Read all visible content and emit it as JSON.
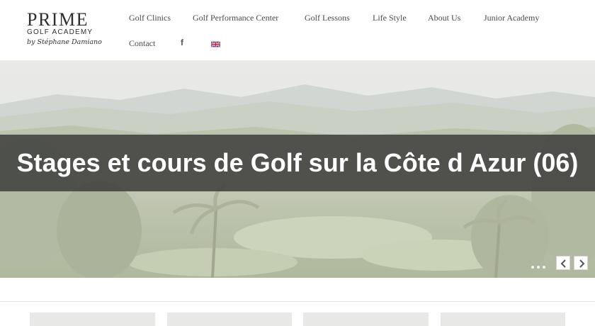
{
  "logo": {
    "main": "PRIME",
    "sub": "GOLF ACADEMY",
    "signature": "by Stéphane Damiano"
  },
  "nav": {
    "items": [
      {
        "label": "Golf Clinics"
      },
      {
        "label": "Golf Performance Center"
      },
      {
        "label": "Golf Lessons"
      },
      {
        "label": "Life Style"
      },
      {
        "label": "About Us"
      },
      {
        "label": "Junior Academy"
      },
      {
        "label": "Contact"
      }
    ],
    "facebook_icon": "f",
    "language_flag": "uk-flag-icon"
  },
  "hero": {
    "title": "Stages et cours de Golf sur la Côte d Azur (06)",
    "slider_dots": 3,
    "prev_icon": "chevron-left-icon",
    "next_icon": "chevron-right-icon"
  },
  "colors": {
    "nav_text": "#4a4a4a",
    "band": "#383838",
    "hero_sky": "#d9ddd9",
    "hero_green": "#a7b08f"
  }
}
